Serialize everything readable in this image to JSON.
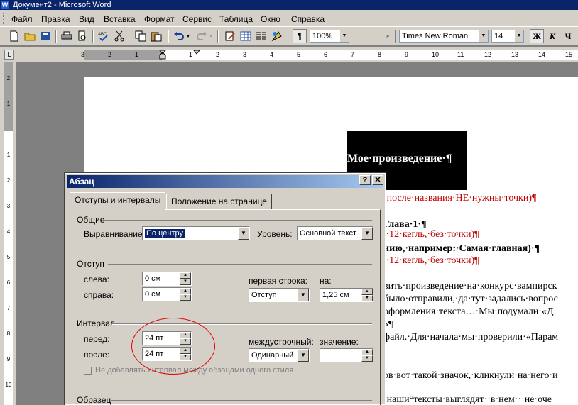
{
  "window": {
    "title": "Документ2 - Microsoft Word",
    "app_icon": "W"
  },
  "menu": [
    "Файл",
    "Правка",
    "Вид",
    "Вставка",
    "Формат",
    "Сервис",
    "Таблица",
    "Окно",
    "Справка"
  ],
  "toolbar": {
    "zoom": "100%",
    "font": "Times New Roman",
    "size": "14",
    "bold": "Ж",
    "italic": "К",
    "underline": "Ч",
    "pilcrow": "¶"
  },
  "ruler": {
    "h_ticks": [
      "3",
      "2",
      "1",
      "1",
      "2",
      "3",
      "4",
      "5",
      "6",
      "7",
      "8",
      "9",
      "10",
      "11",
      "12",
      "13",
      "14",
      "15"
    ],
    "v_ticks": [
      "2",
      "1",
      "1",
      "2",
      "3",
      "4",
      "5",
      "6",
      "7",
      "8",
      "9",
      "10"
    ],
    "corner": "L"
  },
  "document": {
    "title": "Мое·произведение·¶",
    "lines": [
      {
        "text": "(после·названия·НЕ·нужны·точки)¶",
        "style": "red"
      },
      {
        "text": "Глава·1·¶",
        "style": "bold"
      },
      {
        "text": ",·12·кегль,·без·точки)¶",
        "style": "red"
      },
      {
        "text": "нию,·например:·Самая·главная)·¶",
        "style": "bold"
      },
      {
        "text": ",·12·кегль,·без·точки)¶",
        "style": "red"
      },
      {
        "text": "вить·произведение·на·конкурс·вампирск",
        "style": "normal"
      },
      {
        "text": "было·отправили,·да·тут·задались·вопрос",
        "style": "normal"
      },
      {
        "text": "оформления·текста…·Мы·подумали·«Д",
        "style": "normal"
      },
      {
        "text": "»¶",
        "style": "normal"
      },
      {
        "text": "файл.·Для·начала·мы·проверили·«Парам",
        "style": "normal"
      },
      {
        "text": "ов·вот·такой·значок,·кликнули·на·него·и",
        "style": "normal"
      },
      {
        "text": "·наши°тексты·выглядят··в·нем···не·оче",
        "style": "normal"
      }
    ]
  },
  "dialog": {
    "title": "Абзац",
    "help": "?",
    "close": "✕",
    "tabs": [
      "Отступы и интервалы",
      "Положение на странице"
    ],
    "general": {
      "label": "Общие",
      "alignment_label": "Выравнивание:",
      "alignment_value": "По центру",
      "level_label": "Уровень:",
      "level_value": "Основной текст"
    },
    "indent": {
      "label": "Отступ",
      "left_label": "слева:",
      "left_value": "0 см",
      "right_label": "справа:",
      "right_value": "0 см",
      "first_line_label": "первая строка:",
      "first_line_value": "Отступ",
      "by_label": "на:",
      "by_value": "1,25 см"
    },
    "spacing": {
      "label": "Интервал",
      "before_label": "перед:",
      "before_value": "24 пт",
      "after_label": "после:",
      "after_value": "24 пт",
      "line_label": "междустрочный:",
      "line_value": "Одинарный",
      "value_label": "значение:",
      "value_value": "",
      "no_add_label": "Не добавлять интервал между абзацами одного стиля"
    },
    "sample_label": "Образец"
  }
}
